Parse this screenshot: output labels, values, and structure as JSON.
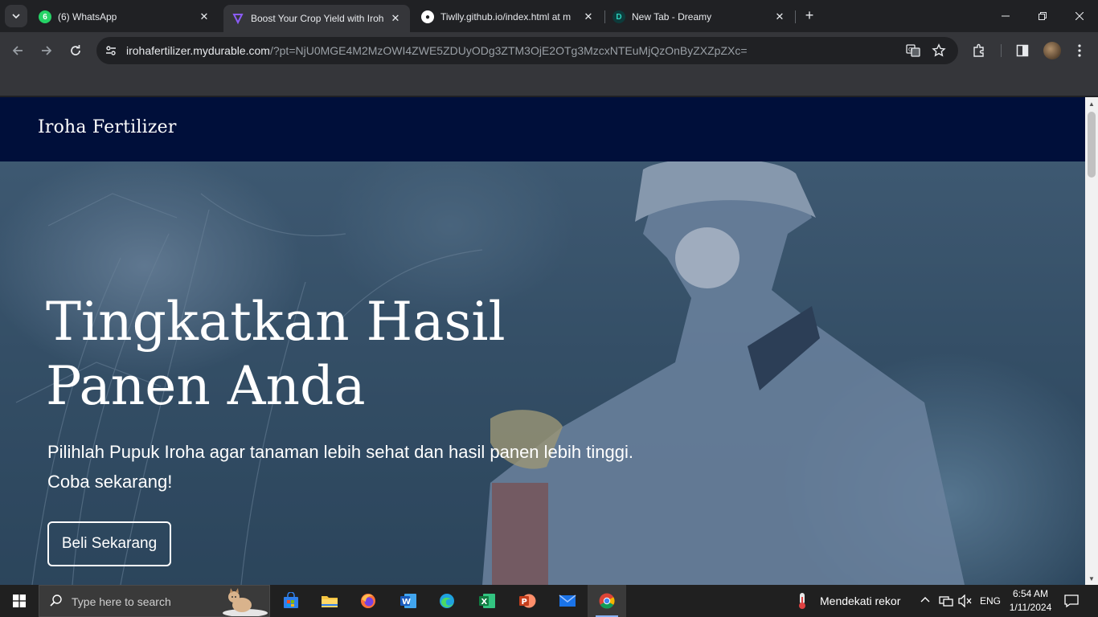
{
  "browser": {
    "tabs": [
      {
        "title": "(6) WhatsApp",
        "badge": "6",
        "icon": "whatsapp-icon"
      },
      {
        "title": "Boost Your Crop Yield with Iroh",
        "icon": "durable-icon",
        "active": true
      },
      {
        "title": "Tiwlly.github.io/index.html at m",
        "icon": "github-icon"
      },
      {
        "title": "New Tab - Dreamy",
        "icon": "dreamy-icon"
      }
    ],
    "url_host": "irohafertilizer.mydurable.com",
    "url_path": "/?pt=NjU0MGE4M2MzOWI4ZWE5ZDUyODg3ZTM3OjE2OTg3MzcxNTEuMjQzOnByZXZpZXc="
  },
  "site": {
    "brand": "Iroha Fertilizer",
    "hero": {
      "title_line1": "Tingkatkan Hasil",
      "title_line2": "Panen Anda",
      "subtitle_line1": "Pilihlah Pupuk Iroha agar tanaman lebih sehat dan hasil panen lebih tinggi.",
      "subtitle_line2": "Coba sekarang!",
      "cta": "Beli Sekarang"
    }
  },
  "taskbar": {
    "search_placeholder": "Type here to search",
    "weather": "Mendekati rekor",
    "language": "ENG",
    "time": "6:54 AM",
    "date": "1/11/2024"
  }
}
